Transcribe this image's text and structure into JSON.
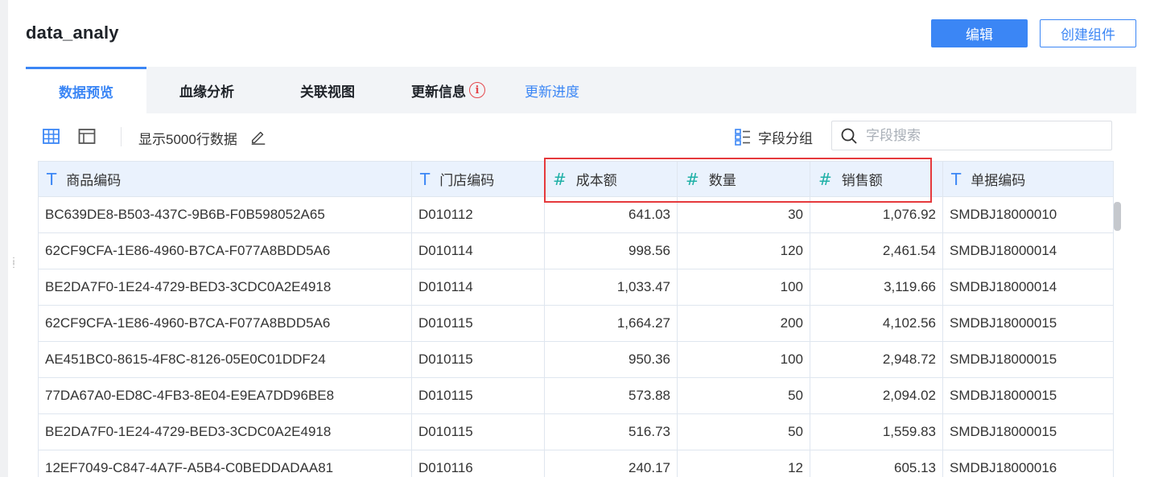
{
  "header": {
    "title": "data_analy",
    "edit_label": "编辑",
    "create_label": "创建组件"
  },
  "tabs": [
    {
      "label": "数据预览",
      "active": true
    },
    {
      "label": "血缘分析",
      "active": false
    },
    {
      "label": "关联视图",
      "active": false
    },
    {
      "label": "更新信息",
      "active": false,
      "icon": "info-icon"
    }
  ],
  "tab_link": "更新进度",
  "toolbar": {
    "grid_icon": "grid-view-icon",
    "layout_icon": "layout-view-icon",
    "rows_label": "显示5000行数据",
    "group_label": "字段分组",
    "search_placeholder": "字段搜索"
  },
  "table": {
    "columns": [
      {
        "type": "T",
        "label": "商品编码"
      },
      {
        "type": "T",
        "label": "门店编码"
      },
      {
        "type": "#",
        "label": "成本额"
      },
      {
        "type": "#",
        "label": "数量"
      },
      {
        "type": "#",
        "label": "销售额"
      },
      {
        "type": "T",
        "label": "单据编码"
      }
    ],
    "rows": [
      [
        "BC639DE8-B503-437C-9B6B-F0B598052A65",
        "D010112",
        "641.03",
        "30",
        "1,076.92",
        "SMDBJ18000010"
      ],
      [
        "62CF9CFA-1E86-4960-B7CA-F077A8BDD5A6",
        "D010114",
        "998.56",
        "120",
        "2,461.54",
        "SMDBJ18000014"
      ],
      [
        "BE2DA7F0-1E24-4729-BED3-3CDC0A2E4918",
        "D010114",
        "1,033.47",
        "100",
        "3,119.66",
        "SMDBJ18000014"
      ],
      [
        "62CF9CFA-1E86-4960-B7CA-F077A8BDD5A6",
        "D010115",
        "1,664.27",
        "200",
        "4,102.56",
        "SMDBJ18000015"
      ],
      [
        "AE451BC0-8615-4F8C-8126-05E0C01DDF24",
        "D010115",
        "950.36",
        "100",
        "2,948.72",
        "SMDBJ18000015"
      ],
      [
        "77DA67A0-ED8C-4FB3-8E04-E9EA7DD96BE8",
        "D010115",
        "573.88",
        "50",
        "2,094.02",
        "SMDBJ18000015"
      ],
      [
        "BE2DA7F0-1E24-4729-BED3-3CDC0A2E4918",
        "D010115",
        "516.73",
        "50",
        "1,559.83",
        "SMDBJ18000015"
      ],
      [
        "12EF7049-C847-4A7F-A5B4-C0BEDDADAA81",
        "D010116",
        "240.17",
        "12",
        "605.13",
        "SMDBJ18000016"
      ]
    ]
  },
  "colors": {
    "accent": "#3b86f5",
    "number_type": "#1fb0a7",
    "highlight": "#e5393c",
    "header_bg": "#eaf2fd"
  }
}
